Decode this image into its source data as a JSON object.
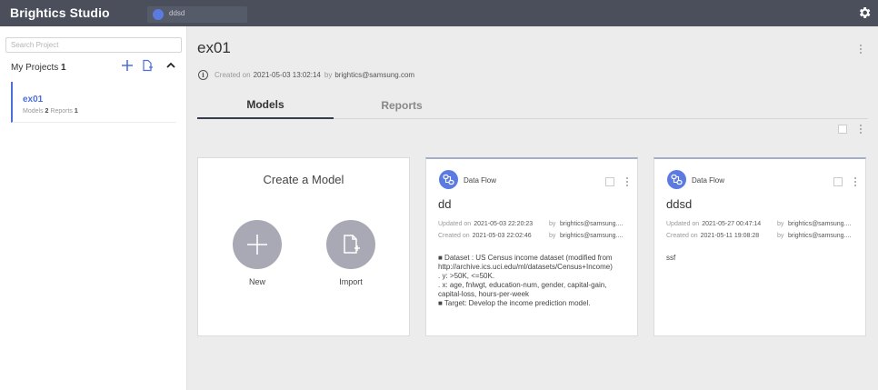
{
  "app": {
    "title": "Brightics Studio",
    "open_tab": "ddsd"
  },
  "sidebar": {
    "search_placeholder": "Search Project",
    "my_projects_label": "My Projects",
    "my_projects_count": "1",
    "projects": [
      {
        "name": "ex01",
        "models_label": "Models",
        "models_count": "2",
        "reports_label": "Reports",
        "reports_count": "1"
      }
    ]
  },
  "project": {
    "title": "ex01",
    "created_label": "Created on",
    "created_at": "2021-05-03 13:02:14",
    "by_label": "by",
    "created_by": "brightics@samsung.com"
  },
  "tabs": [
    {
      "label": "Models",
      "active": true
    },
    {
      "label": "Reports",
      "active": false
    }
  ],
  "create_card": {
    "title": "Create a Model",
    "new_label": "New",
    "import_label": "Import"
  },
  "models": [
    {
      "type": "Data Flow",
      "name": "dd",
      "updated_label": "Updated on",
      "updated_at": "2021-05-03 22:20:23",
      "created_label": "Created on",
      "created_at": "2021-05-03 22:02:46",
      "by_label": "by",
      "updated_by": "brightics@samsung....",
      "created_by": "brightics@samsung....",
      "description": "■ Dataset : US Census income dataset (modified from http://archive.ics.uci.edu/ml/datasets/Census+Income)\n . y: >50K, <=50K.\n . x: age, fnlwgt, education-num, gender, capital-gain, capital-loss, hours-per-week\n■ Target: Develop the income prediction model."
    },
    {
      "type": "Data Flow",
      "name": "ddsd",
      "updated_label": "Updated on",
      "updated_at": "2021-05-27 00:47:14",
      "created_label": "Created on",
      "created_at": "2021-05-11 19:08:28",
      "by_label": "by",
      "updated_by": "brightics@samsung....",
      "created_by": "brightics@samsung....",
      "description": "ssf"
    }
  ],
  "colors": {
    "topbar": "#4b4f5c",
    "accent": "#4d6fd8",
    "flow_icon": "#5b7be0",
    "circle_button": "#a9a9b5"
  }
}
